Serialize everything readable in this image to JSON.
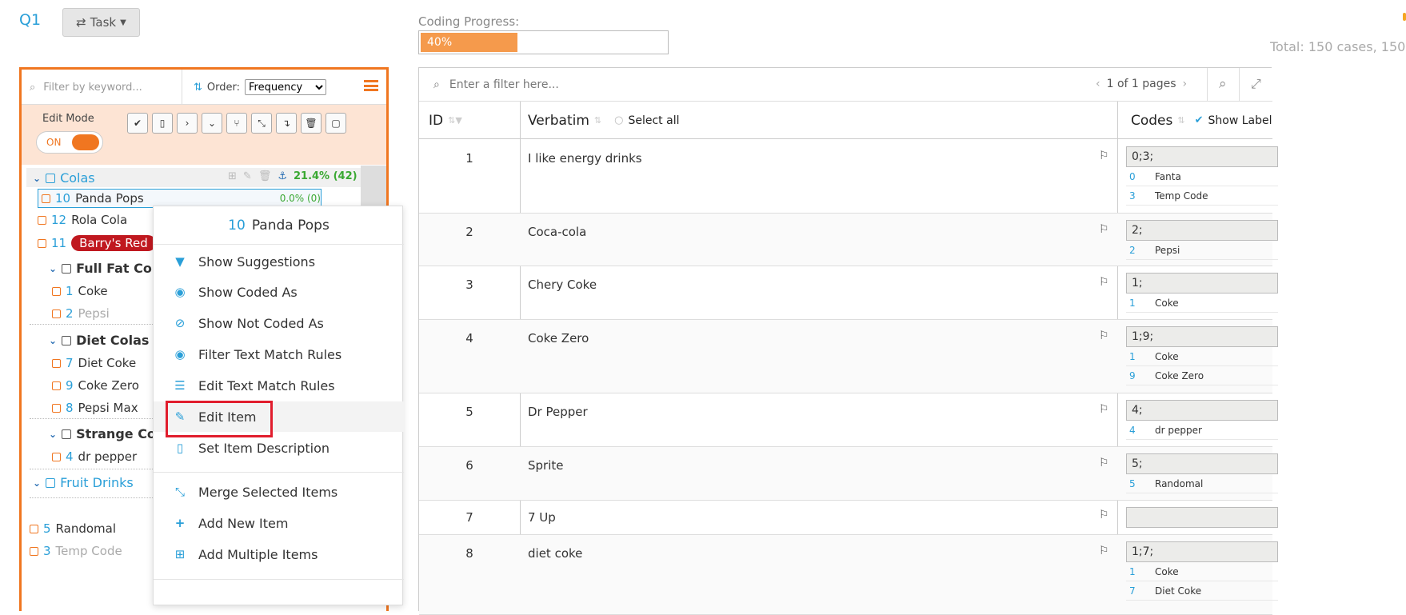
{
  "header": {
    "question": "Q1",
    "task_button": "Task",
    "progress_label": "Coding Progress:",
    "progress_text": "40%",
    "progress_value": 0.4,
    "total_text": "Total: 150 cases, 150"
  },
  "panel": {
    "keyword_placeholder": "Filter by keyword...",
    "order_label": "Order:",
    "order_value": "Frequency",
    "edit_mode_label": "Edit Mode",
    "toggle_label": "ON",
    "group_colas": {
      "label": "Colas",
      "stat": "21.4% (42)"
    },
    "items": [
      {
        "num": "10",
        "label": "Panda Pops",
        "stat": "0.0% (0)"
      },
      {
        "num": "12",
        "label": "Rola Cola"
      },
      {
        "num": "11",
        "label": "Barry's Red"
      },
      {
        "num": "1",
        "label": "Coke"
      },
      {
        "num": "2",
        "label": "Pepsi"
      },
      {
        "num": "7",
        "label": "Diet Coke"
      },
      {
        "num": "9",
        "label": "Coke Zero"
      },
      {
        "num": "8",
        "label": "Pepsi Max"
      },
      {
        "num": "4",
        "label": "dr pepper"
      },
      {
        "num": "5",
        "label": "Randomal"
      },
      {
        "num": "3",
        "label": "Temp Code"
      }
    ],
    "subgroups": [
      "Full Fat Co",
      "Diet Colas",
      "Strange Co"
    ],
    "group_fruit": "Fruit Drinks"
  },
  "context_menu": {
    "title_num": "10",
    "title_label": "Panda Pops",
    "items": [
      "Show Suggestions",
      "Show Coded As",
      "Show Not Coded As",
      "Filter Text Match Rules",
      "Edit Text Match Rules",
      "Edit Item",
      "Set Item Description",
      "Merge Selected Items",
      "Add New Item",
      "Add Multiple Items"
    ]
  },
  "grid": {
    "filter_placeholder": "Enter a filter here...",
    "pager": "1 of 1 pages",
    "col_id": "ID",
    "col_verbatim": "Verbatim",
    "select_all": "Select all",
    "col_codes": "Codes",
    "show_labels": "Show Label",
    "rows": [
      {
        "id": "1",
        "verbatim": "I like energy drinks",
        "codes": "0;3;",
        "labels": [
          [
            "0",
            "Fanta"
          ],
          [
            "3",
            "Temp Code"
          ]
        ]
      },
      {
        "id": "2",
        "verbatim": "Coca-cola",
        "codes": "2;",
        "labels": [
          [
            "2",
            "Pepsi"
          ]
        ]
      },
      {
        "id": "3",
        "verbatim": "Chery Coke",
        "codes": "1;",
        "labels": [
          [
            "1",
            "Coke"
          ]
        ]
      },
      {
        "id": "4",
        "verbatim": "Coke Zero",
        "codes": "1;9;",
        "labels": [
          [
            "1",
            "Coke"
          ],
          [
            "9",
            "Coke Zero"
          ]
        ]
      },
      {
        "id": "5",
        "verbatim": "Dr Pepper",
        "codes": "4;",
        "labels": [
          [
            "4",
            "dr pepper"
          ]
        ]
      },
      {
        "id": "6",
        "verbatim": "Sprite",
        "codes": "5;",
        "labels": [
          [
            "5",
            "Randomal"
          ]
        ]
      },
      {
        "id": "7",
        "verbatim": "7 Up",
        "codes": "",
        "labels": []
      },
      {
        "id": "8",
        "verbatim": "diet coke",
        "codes": "1;7;",
        "labels": [
          [
            "1",
            "Coke"
          ],
          [
            "7",
            "Diet Coke"
          ]
        ]
      }
    ]
  },
  "colors": {
    "accent_orange": "#f07620",
    "accent_blue": "#2a9fd8",
    "highlight_red": "#e11d2d",
    "badge_red": "#c0181f"
  }
}
